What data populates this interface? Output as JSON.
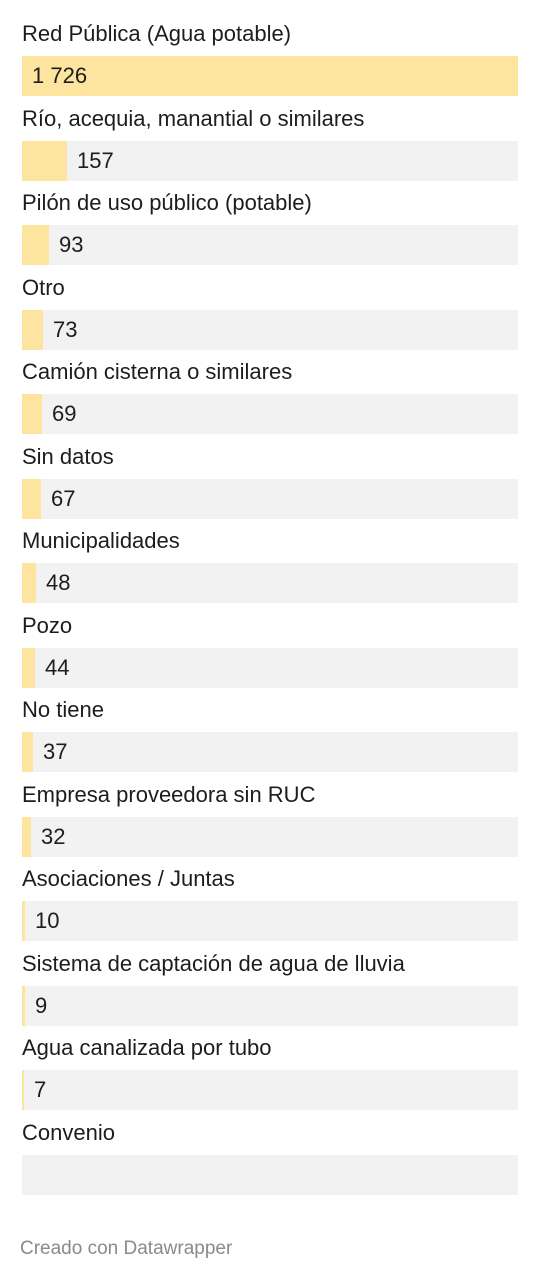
{
  "chart_data": {
    "type": "bar",
    "orientation": "horizontal",
    "categories": [
      "Red Pública (Agua potable)",
      "Río, acequia, manantial o similares",
      "Pilón de uso público (potable)",
      "Otro",
      "Camión cisterna o similares",
      "Sin datos",
      "Municipalidades",
      "Pozo",
      "No tiene",
      "Empresa proveedora sin RUC",
      "Asociaciones / Juntas",
      "Sistema de captación de agua de lluvia",
      "Agua canalizada por tubo",
      "Convenio"
    ],
    "values": [
      1726,
      157,
      93,
      73,
      69,
      67,
      48,
      44,
      37,
      32,
      10,
      9,
      7,
      null
    ],
    "value_labels": [
      "1 726",
      "157",
      "93",
      "73",
      "69",
      "67",
      "48",
      "44",
      "37",
      "32",
      "10",
      "9",
      "7",
      ""
    ],
    "bar_color": "#fde49f",
    "track_color": "#f2f2f2"
  },
  "footer": {
    "credit": "Creado con Datawrapper"
  }
}
